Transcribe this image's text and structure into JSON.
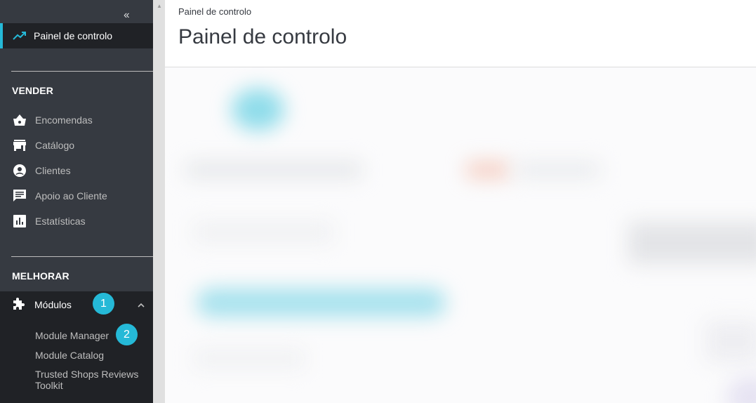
{
  "sidebar": {
    "collapse_symbol": "‹‹",
    "active_item": {
      "label": "Painel de controlo",
      "icon": "trending-up-icon"
    },
    "sections": [
      {
        "title": "VENDER",
        "items": [
          {
            "label": "Encomendas",
            "icon": "basket-icon"
          },
          {
            "label": "Catálogo",
            "icon": "store-icon"
          },
          {
            "label": "Clientes",
            "icon": "account-circle-icon"
          },
          {
            "label": "Apoio ao Cliente",
            "icon": "chat-icon"
          },
          {
            "label": "Estatísticas",
            "icon": "bar-chart-icon"
          }
        ]
      },
      {
        "title": "MELHORAR",
        "items": [
          {
            "label": "Módulos",
            "icon": "puzzle-icon",
            "badge": "1",
            "expanded": true,
            "children": [
              {
                "label": "Module Manager",
                "badge": "2"
              },
              {
                "label": "Module Catalog"
              },
              {
                "label": "Trusted Shops Reviews Toolkit"
              }
            ]
          }
        ]
      }
    ]
  },
  "header": {
    "breadcrumb": "Painel de controlo",
    "title": "Painel de controlo"
  },
  "colors": {
    "sidebar_bg": "#363a41",
    "sidebar_active_bg": "#202226",
    "accent": "#25b9d7"
  }
}
